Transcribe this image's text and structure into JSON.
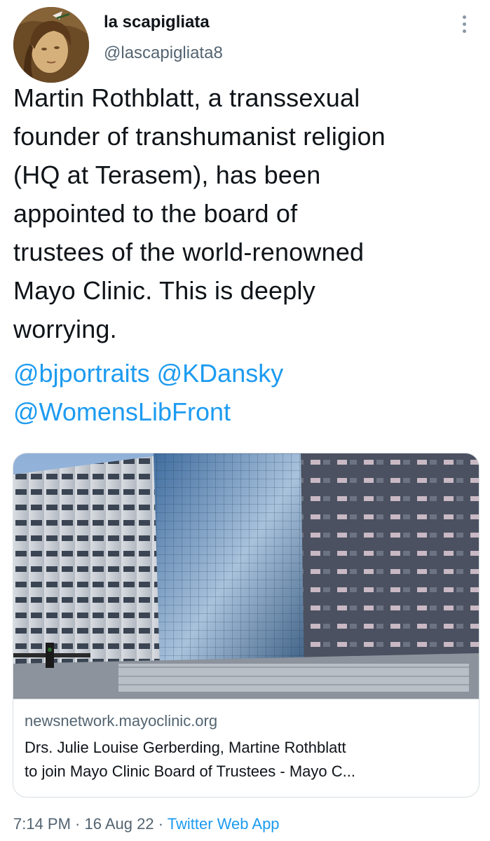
{
  "author": {
    "display_name": "la scapigliata",
    "handle": "@lascapigliata8",
    "avatar_icon": "portrait-avatar"
  },
  "tweet": {
    "text_lines": [
      "Martin Rothblatt, a transsexual",
      "founder of transhumanist religion",
      "(HQ at Terasem), has been",
      "appointed to the board of",
      "trustees of the world-renowned",
      "Mayo Clinic. This is deeply",
      "worrying."
    ],
    "mentions": [
      "@bjportraits",
      "@KDansky",
      "@WomensLibFront"
    ]
  },
  "link_card": {
    "domain": "newsnetwork.mayoclinic.org",
    "title_lines": [
      "Drs. Julie Louise Gerberding, Martine Rothblatt",
      "to join Mayo Clinic Board of Trustees - Mayo C..."
    ],
    "image_icon": "building-photo"
  },
  "meta": {
    "time": "7:14 PM",
    "separator": " · ",
    "date": "16 Aug 22",
    "source": "Twitter Web App"
  },
  "colors": {
    "link": "#1d9bf0",
    "text": "#0f1419",
    "secondary": "#536471",
    "border": "#d8dee3"
  }
}
